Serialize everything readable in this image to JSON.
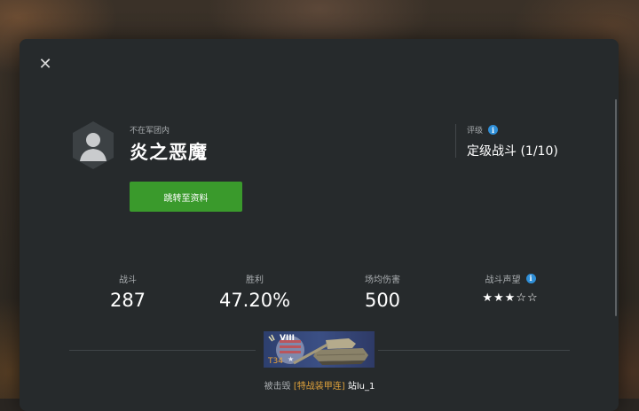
{
  "close_icon": "close-icon",
  "profile": {
    "clan_status": "不在军团内",
    "player_name": "炎之恶魔",
    "profile_button_label": "跳转至资料"
  },
  "rating": {
    "label": "评级",
    "value": "定级战斗 (1/10)"
  },
  "stats": {
    "battles_label": "战斗",
    "battles_value": "287",
    "winrate_label": "胜利",
    "winrate_value": "47.20%",
    "avg_damage_label": "场均伤害",
    "avg_damage_value": "500",
    "reputation_label": "战斗声望",
    "reputation_stars": "★★★☆☆",
    "reputation_level": 3,
    "reputation_max": 5
  },
  "tank": {
    "tier": "VIII",
    "name": "T34",
    "nation": "USA"
  },
  "destroyed_by": {
    "prefix": "被击毁",
    "clan_tag": "[特战装甲连]",
    "player": "站lu_1"
  },
  "colors": {
    "accent_green": "#3a9a2c",
    "info_blue": "#2f8fd8",
    "clan_orange": "#e0a23b"
  }
}
